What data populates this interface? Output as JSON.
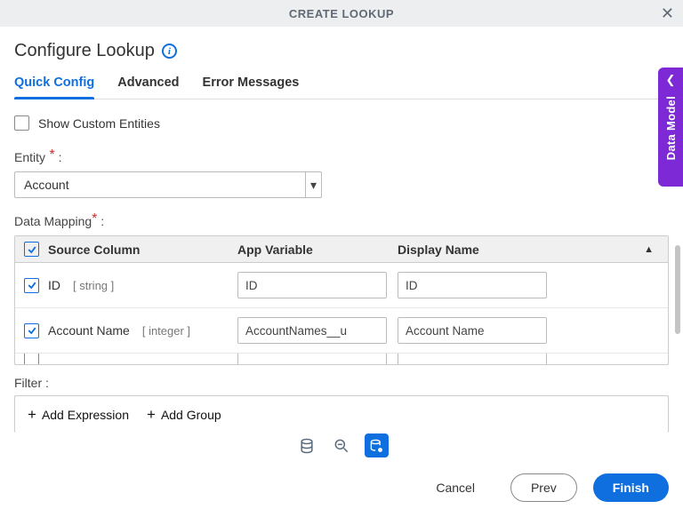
{
  "header": {
    "title": "CREATE LOOKUP"
  },
  "page": {
    "title": "Configure Lookup"
  },
  "tabs": [
    {
      "label": "Quick Config",
      "active": true
    },
    {
      "label": "Advanced",
      "active": false
    },
    {
      "label": "Error Messages",
      "active": false
    }
  ],
  "showCustomEntities": {
    "label": "Show Custom Entities",
    "checked": false
  },
  "entity": {
    "label": "Entity",
    "value": "Account"
  },
  "dataMapping": {
    "label": "Data Mapping",
    "headers": {
      "source": "Source Column",
      "appvar": "App Variable",
      "display": "Display Name"
    },
    "rows": [
      {
        "checked": true,
        "name": "ID",
        "type": "string",
        "appvar": "ID",
        "display": "ID"
      },
      {
        "checked": true,
        "name": "Account Name",
        "type": "integer",
        "appvar": "AccountNames__u",
        "display": "Account Name"
      }
    ]
  },
  "filter": {
    "label": "Filter :",
    "addExpression": "Add Expression",
    "addGroup": "Add Group"
  },
  "footer": {
    "cancel": "Cancel",
    "prev": "Prev",
    "finish": "Finish"
  },
  "sidePanel": {
    "label": "Data Model"
  }
}
